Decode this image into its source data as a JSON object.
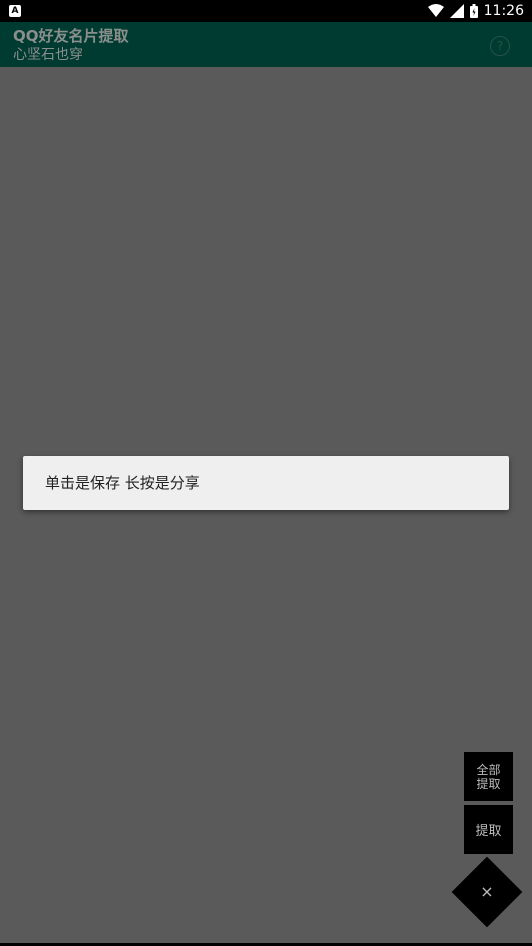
{
  "status_bar": {
    "notification_icon_glyph": "A",
    "time": "11:26",
    "icons": [
      "wifi-icon",
      "signal-icon",
      "battery-icon"
    ]
  },
  "app_bar": {
    "title": "QQ好友名片提取",
    "subtitle": "心坚石也穿",
    "help_glyph": "?",
    "background_color": "#003b32"
  },
  "toast": {
    "message": "单击是保存 长按是分享"
  },
  "fab": {
    "extract_all_label": "全部\n提取",
    "extract_label": "提取",
    "close_glyph": "×"
  }
}
